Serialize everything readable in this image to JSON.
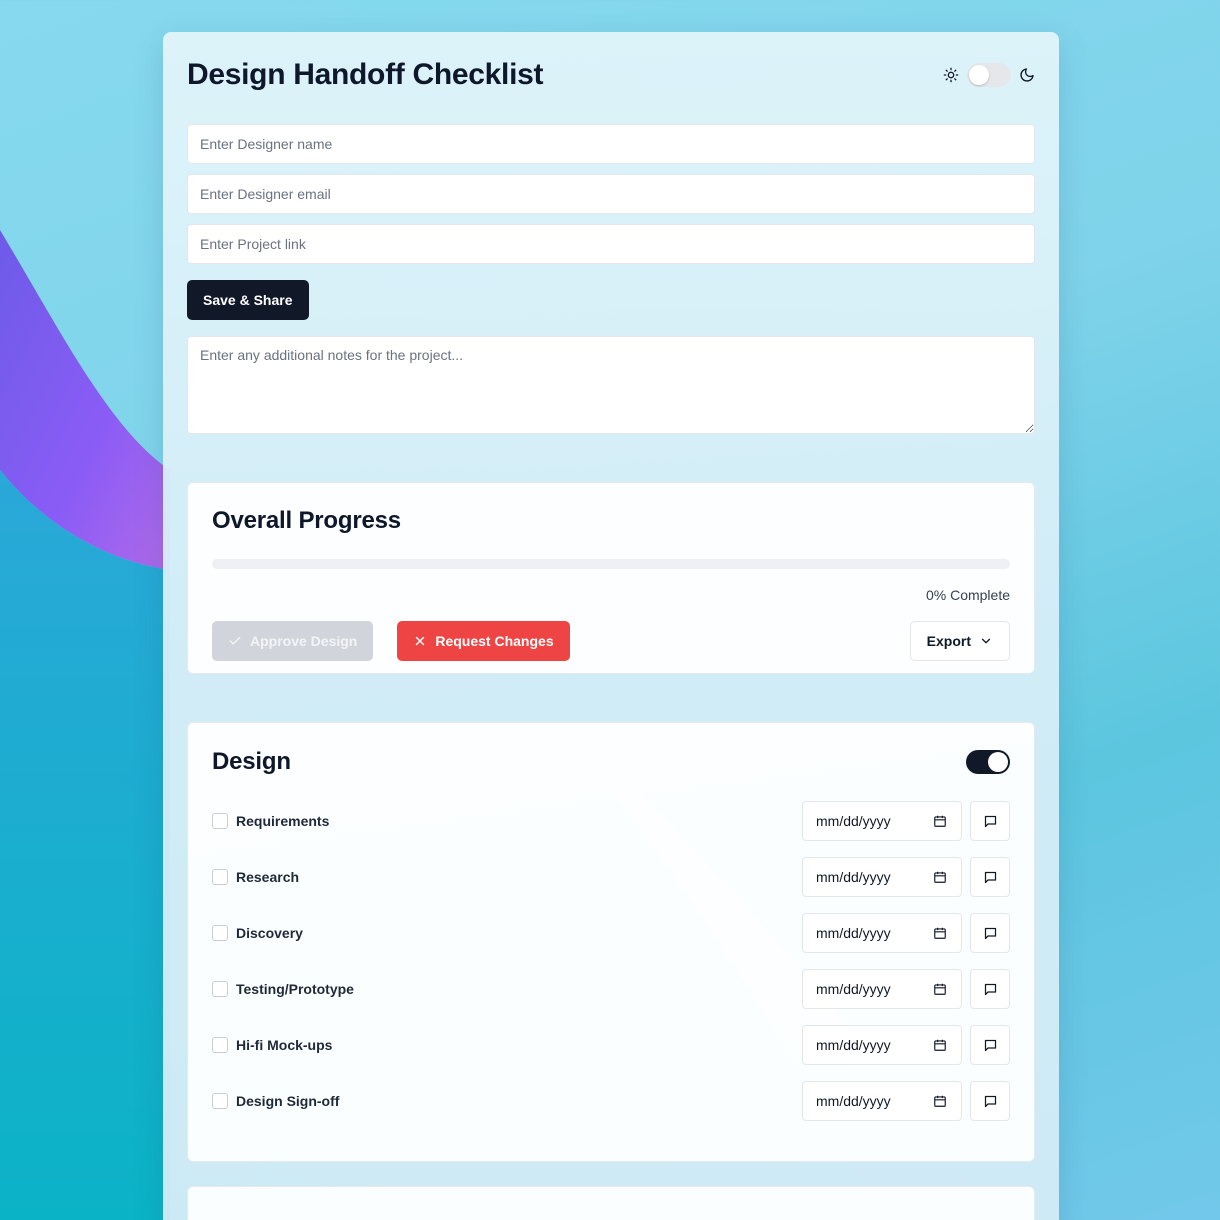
{
  "header": {
    "title": "Design Handoff Checklist"
  },
  "form": {
    "designer_name_placeholder": "Enter Designer name",
    "designer_email_placeholder": "Enter Designer email",
    "project_link_placeholder": "Enter Project link",
    "save_label": "Save & Share",
    "notes_placeholder": "Enter any additional notes for the project..."
  },
  "progress": {
    "title": "Overall Progress",
    "percent": 0,
    "percent_label": "0% Complete",
    "approve_label": "Approve Design",
    "request_label": "Request Changes",
    "export_label": "Export"
  },
  "design": {
    "title": "Design",
    "enabled": true,
    "date_placeholder": "mm/dd/yyyy",
    "items": [
      {
        "label": "Requirements",
        "checked": false,
        "date": "mm/dd/yyyy"
      },
      {
        "label": "Research",
        "checked": false,
        "date": "mm/dd/yyyy"
      },
      {
        "label": "Discovery",
        "checked": false,
        "date": "mm/dd/yyyy"
      },
      {
        "label": "Testing/Prototype",
        "checked": false,
        "date": "mm/dd/yyyy"
      },
      {
        "label": "Hi-fi Mock-ups",
        "checked": false,
        "date": "mm/dd/yyyy"
      },
      {
        "label": "Design Sign-off",
        "checked": false,
        "date": "mm/dd/yyyy"
      }
    ]
  },
  "theme": {
    "dark_mode": false,
    "icons": [
      "sun-icon",
      "moon-icon"
    ]
  },
  "colors": {
    "primary": "#111827",
    "danger": "#ef4444",
    "disabled": "#d1d5db"
  }
}
